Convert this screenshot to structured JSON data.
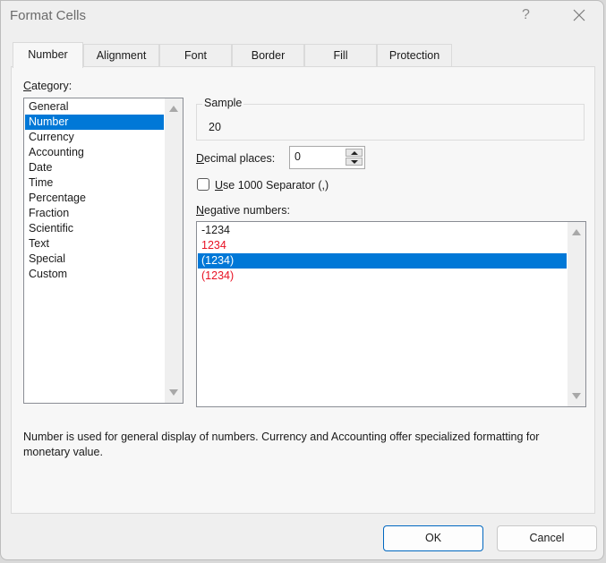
{
  "window": {
    "title": "Format Cells",
    "help_label": "?"
  },
  "tabs": [
    {
      "label": "Number",
      "active": true
    },
    {
      "label": "Alignment"
    },
    {
      "label": "Font"
    },
    {
      "label": "Border"
    },
    {
      "label": "Fill"
    },
    {
      "label": "Protection"
    }
  ],
  "category": {
    "label_accel": "C",
    "label_rest": "ategory:",
    "items": [
      "General",
      "Number",
      "Currency",
      "Accounting",
      "Date",
      "Time",
      "Percentage",
      "Fraction",
      "Scientific",
      "Text",
      "Special",
      "Custom"
    ],
    "selected": "Number"
  },
  "sample": {
    "legend": "Sample",
    "value": "20"
  },
  "decimal_places": {
    "label_accel": "D",
    "label_rest": "ecimal places:",
    "value": "0"
  },
  "separator": {
    "label_accel": "U",
    "label_rest": "se 1000 Separator (,)",
    "checked": false
  },
  "negative_numbers": {
    "label_accel": "N",
    "label_rest": "egative numbers:",
    "items": [
      {
        "text": "-1234",
        "color": "#1a1a1a"
      },
      {
        "text": "1234",
        "color": "#e81123"
      },
      {
        "text": "(1234)",
        "color": "#ffffff"
      },
      {
        "text": "(1234)",
        "color": "#e81123"
      }
    ],
    "selected_index": 2
  },
  "description": "Number is used for general display of numbers.  Currency and Accounting offer specialized formatting for monetary value.",
  "buttons": {
    "ok": "OK",
    "cancel": "Cancel"
  },
  "colors": {
    "selection": "#0078d7",
    "negative_red": "#e81123",
    "ok_border": "#0067c0"
  }
}
